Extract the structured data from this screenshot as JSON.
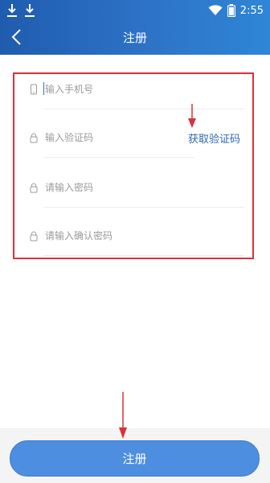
{
  "status_bar": {
    "time": "2:55"
  },
  "header": {
    "title": "注册"
  },
  "form": {
    "phone_placeholder": "输入手机号",
    "code_placeholder": "输入验证码",
    "get_code_label": "获取验证码",
    "password_placeholder": "请输入密码",
    "confirm_password_placeholder": "请输入确认密码"
  },
  "footer": {
    "submit_label": "注册"
  },
  "colors": {
    "header_start": "#1f5cae",
    "header_end": "#2f86d6",
    "accent": "#2c68b0",
    "button": "#4d8ee0",
    "highlight_box": "#d8323b"
  }
}
